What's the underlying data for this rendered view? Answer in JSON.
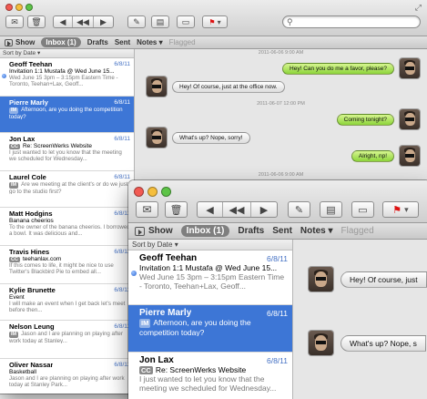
{
  "toolbar": {
    "search_placeholder": ""
  },
  "filter": {
    "show_label": "Show",
    "inbox_label": "Inbox (1)",
    "drafts_label": "Drafts",
    "sent_label": "Sent",
    "notes_label": "Notes",
    "flagged_label": "Flagged"
  },
  "sort": {
    "label": "Sort by Date"
  },
  "back_list": [
    {
      "from": "Geoff Teehan",
      "date": "6/8/11",
      "subject": "Invitation 1:1 Mustafa @ Wed June 15...",
      "preview": "Wed June 15 3pm – 3:15pm Eastern Time - Toronto, Teehan+Lax, Geoff..."
    },
    {
      "from": "Pierre Marly",
      "date": "6/8/11",
      "tag": "IM",
      "preview": "Afternoon, are you doing the competition today?"
    },
    {
      "from": "Jon Lax",
      "date": "6/8/11",
      "tag": "CC",
      "subject": "Re: ScreenWerks Website",
      "preview": "I just wanted to let you know that the meeting we scheduled for Wednesday..."
    },
    {
      "from": "Laurel Cole",
      "date": "6/8/11",
      "tag": "IM",
      "preview": "Are we meeting at the client's or do we just go to the studio first?"
    },
    {
      "from": "Matt Hodgins",
      "date": "6/8/11",
      "subject": "Banana cheerios",
      "preview": "To the owner of the banana cheerios. I borrowed a bowl. It was delicious and..."
    },
    {
      "from": "Travis Hines",
      "date": "6/8/11",
      "tag": "CC",
      "subject": "teehanlax.com",
      "preview": "If this comes to life, it might be nice to use Twitter's Blackbird Pie to embed all..."
    },
    {
      "from": "Kylie Brunette",
      "date": "6/8/11",
      "subject": "Event",
      "preview": "I will make an event when I get back let's meet before then..."
    },
    {
      "from": "Nelson Leung",
      "date": "6/8/11",
      "tag": "IM",
      "preview": "Jason and I are planning on playing after work today at Stanley..."
    },
    {
      "from": "Oliver Nassar",
      "date": "6/8/11",
      "subject": "Basketball",
      "preview": "Jason and I are planning on playing after work today at Stanley Park..."
    }
  ],
  "chat": {
    "timestamps": [
      "2011-06-06 9:00 AM",
      "2011-06-07 12:00 PM",
      "2011-06-06 9:00 AM"
    ],
    "messages": [
      {
        "side": "right",
        "text": "Hey! Can you do me a favor, please?"
      },
      {
        "side": "left",
        "text": "Hey! Of course, just at the office now."
      },
      {
        "side": "right",
        "text": "Coming tonight?"
      },
      {
        "side": "left",
        "text": "What's up? Nope, sorry!"
      },
      {
        "side": "right",
        "text": "Alright, np!"
      }
    ]
  },
  "front_list": [
    {
      "from": "Geoff Teehan",
      "date": "6/8/11",
      "subject": "Invitation 1:1 Mustafa @ Wed June 15...",
      "preview": "Wed June 15 3pm – 3:15pm Eastern Time - Toronto, Teehan+Lax, Geoff..."
    },
    {
      "from": "Pierre Marly",
      "date": "6/8/11",
      "tag": "IM",
      "preview": "Afternoon, are you doing the competition today?"
    },
    {
      "from": "Jon Lax",
      "date": "6/8/11",
      "tag": "CC",
      "subject": "Re: ScreenWerks Website",
      "preview": "I just wanted to let you know that the meeting we scheduled for Wednesday..."
    }
  ],
  "front_chat": [
    {
      "text": "Hey! Of course, just"
    },
    {
      "text": "What's up? Nope, s"
    }
  ],
  "colors": {
    "selection": "#3d76d6",
    "bubble_green": "#a6e256",
    "chat_bg": "#e6e6e6"
  },
  "icons": [
    "close-light",
    "minimize-light",
    "zoom-light",
    "compose-icon",
    "delete-icon",
    "reply-icon",
    "reply-all-icon",
    "forward-icon",
    "edit-icon",
    "note-icon",
    "archive-icon",
    "flag-icon",
    "search-icon",
    "resize-icon"
  ]
}
